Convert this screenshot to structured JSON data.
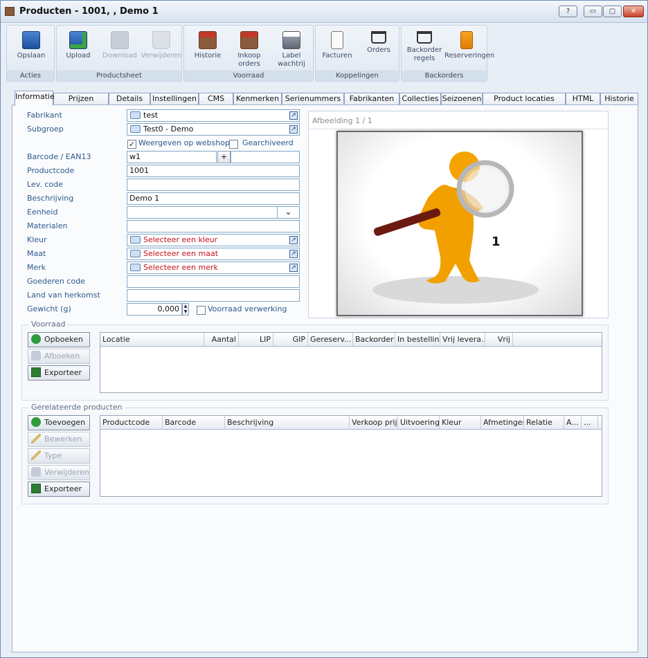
{
  "window": {
    "title": "Producten - 1001, , Demo 1",
    "buttons": {
      "help": "?",
      "minimize": "▭",
      "maximize": "▢",
      "close": "✕"
    }
  },
  "ribbon": {
    "groups": [
      {
        "label": "Acties"
      },
      {
        "label": "Productsheet"
      },
      {
        "label": "Voorraad"
      },
      {
        "label": "Koppelingen"
      },
      {
        "label": "Backorders"
      }
    ],
    "buttons": {
      "opslaan": "Opslaan",
      "upload": "Upload",
      "download": "Download",
      "verwijderen": "Verwijderen",
      "historie": "Historie",
      "inkoop_line1": "Inkoop",
      "inkoop_line2": "orders",
      "label_line1": "Label",
      "label_line2": "wachtrij",
      "facturen": "Facturen",
      "orders": "Orders",
      "backorder_line1": "Backorder",
      "backorder_line2": "regels",
      "reserveringen": "Reserveringen"
    }
  },
  "tabs": [
    "Informatie",
    "Prijzen",
    "Details",
    "Instellingen",
    "CMS",
    "Kenmerken",
    "Serienummers",
    "Fabrikanten",
    "Collecties",
    "Seizoenen",
    "Product locaties",
    "HTML",
    "Historie"
  ],
  "form": {
    "labels": {
      "fabrikant": "Fabrikant",
      "subgroep": "Subgroep",
      "barcode": "Barcode / EAN13",
      "productcode": "Productcode",
      "levcode": "Lev. code",
      "beschrijving": "Beschrijving",
      "eenheid": "Eenheid",
      "materialen": "Materialen",
      "kleur": "Kleur",
      "maat": "Maat",
      "merk": "Merk",
      "goederencode": "Goederen code",
      "land": "Land van herkomst",
      "gewicht": "Gewicht (g)"
    },
    "values": {
      "fabrikant": "test",
      "subgroep": "Test0 - Demo",
      "barcode": "w1",
      "productcode": "1001",
      "levcode": "",
      "beschrijving": "Demo 1",
      "eenheid": "",
      "materialen": "",
      "kleur": "Selecteer een kleur",
      "maat": "Selecteer een maat",
      "merk": "Selecteer een merk",
      "goederencode": "",
      "land": "",
      "gewicht": "0,000"
    },
    "barcode_add": "+",
    "checkboxes": {
      "webshop": {
        "label": "Weergeven op webshop",
        "checked": true
      },
      "archived": {
        "label": "Gearchiveerd",
        "checked": false
      },
      "voorraad": {
        "label": "Voorraad verwerking",
        "checked": false
      }
    }
  },
  "image_panel": {
    "header": "Afbeelding 1 / 1",
    "overlay_number": "1"
  },
  "voorraad": {
    "title": "Voorraad",
    "buttons": {
      "opboeken": "Opboeken",
      "afboeken": "Afboeken",
      "exporteer": "Exporteer"
    },
    "columns": [
      "Locatie",
      "Aantal",
      "LIP",
      "GIP",
      "Gereserv...",
      "Backorder",
      "In bestelling",
      "Vrij levera...",
      "Vrij"
    ]
  },
  "gerelateerde": {
    "title": "Gerelateerde producten",
    "buttons": {
      "toevoegen": "Toevoegen",
      "bewerken": "Bewerken",
      "type": "Type",
      "verwijderen": "Verwijderen",
      "exporteer": "Exporteer"
    },
    "columns": [
      "Productcode",
      "Barcode",
      "Beschrijving",
      "Verkoop prijs",
      "Uitvoering",
      "Kleur",
      "Afmetingen",
      "Relatie",
      "A...",
      "..."
    ]
  },
  "colors": {
    "label": "#2c5a8c",
    "placeholder_red": "#c4121b",
    "accent": "#7fa8c8"
  }
}
